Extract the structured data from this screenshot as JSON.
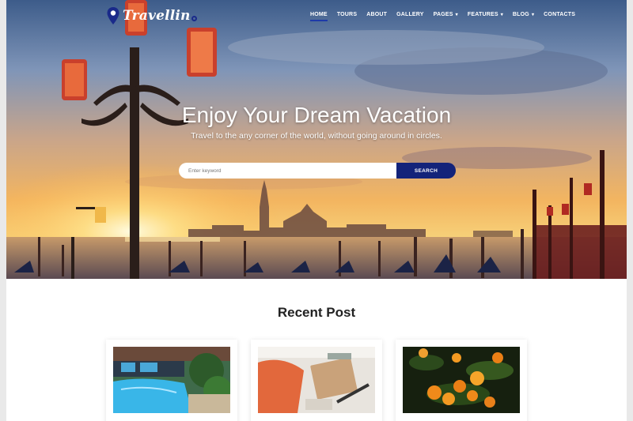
{
  "brand": {
    "name": "Travellin",
    "accent_color": "#13237a"
  },
  "nav": {
    "items": [
      {
        "label": "HOME",
        "active": true,
        "has_dropdown": false
      },
      {
        "label": "TOURS",
        "active": false,
        "has_dropdown": false
      },
      {
        "label": "ABOUT",
        "active": false,
        "has_dropdown": false
      },
      {
        "label": "GALLERY",
        "active": false,
        "has_dropdown": false
      },
      {
        "label": "PAGES",
        "active": false,
        "has_dropdown": true
      },
      {
        "label": "FEATURES",
        "active": false,
        "has_dropdown": true
      },
      {
        "label": "BLOG",
        "active": false,
        "has_dropdown": true
      },
      {
        "label": "CONTACTS",
        "active": false,
        "has_dropdown": false
      }
    ],
    "dropdown_icon": "chevron-down-icon"
  },
  "hero": {
    "title": "Enjoy Your Dream Vacation",
    "subtitle": "Travel to the any corner of the world, without going around in circles.",
    "search": {
      "placeholder": "Enter keyword",
      "value": "",
      "button_label": "SEARCH"
    }
  },
  "recent": {
    "title": "Recent Post",
    "posts": [
      {
        "image": "resort-pool-photo"
      },
      {
        "image": "desk-workspace-photo"
      },
      {
        "image": "orange-tree-photo"
      }
    ]
  }
}
